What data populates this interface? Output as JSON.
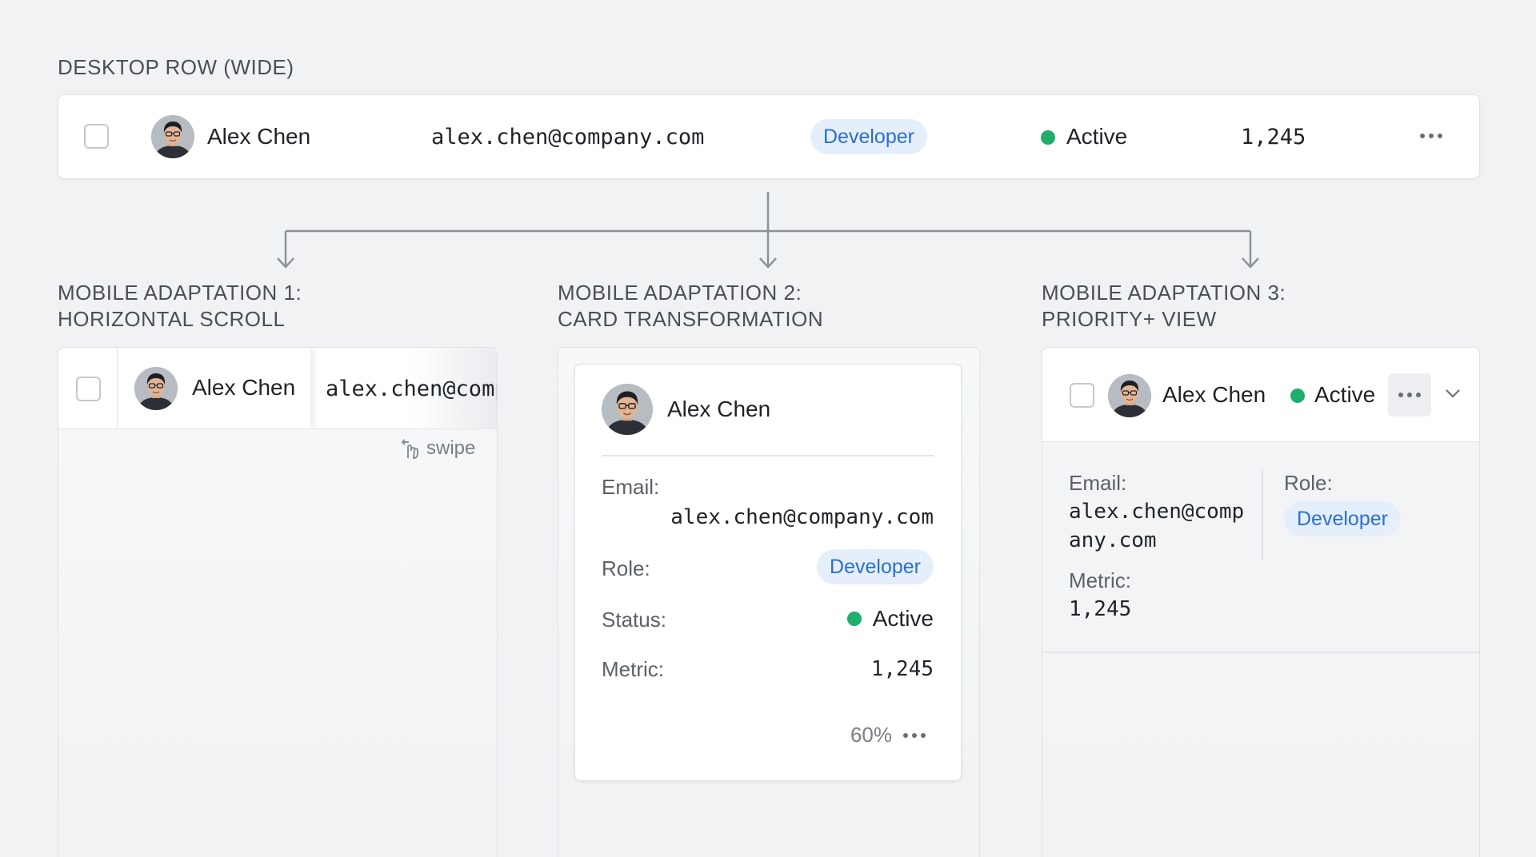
{
  "desktop": {
    "section_label": "DESKTOP ROW (WIDE)",
    "name": "Alex Chen",
    "email": "alex.chen@company.com",
    "role": "Developer",
    "status": "Active",
    "metric": "1,245"
  },
  "mobile1": {
    "section_label_line1": "MOBILE ADAPTATION 1:",
    "section_label_line2": "HORIZONTAL SCROLL",
    "name": "Alex Chen",
    "email_partial": "alex.chen@comp",
    "swipe_label": "swipe"
  },
  "mobile2": {
    "section_label_line1": "MOBILE ADAPTATION 2:",
    "section_label_line2": "CARD TRANSFORMATION",
    "name": "Alex Chen",
    "email_label": "Email:",
    "email": "alex.chen@company.com",
    "role_label": "Role:",
    "role": "Developer",
    "status_label": "Status:",
    "status": "Active",
    "metric_label": "Metric:",
    "metric": "1,245",
    "progress_text": "60%"
  },
  "mobile3": {
    "section_label_line1": "MOBILE ADAPTATION 3:",
    "section_label_line2": "PRIORITY+ VIEW",
    "name": "Alex Chen",
    "status": "Active",
    "email_label": "Email:",
    "email_line1": "alex.chen@comp",
    "email_line2": "any.com",
    "metric_label": "Metric:",
    "metric": "1,245",
    "role_label": "Role:",
    "role": "Developer"
  },
  "icons": {
    "more": "more-horizontal-icon",
    "chevron": "chevron-down-icon",
    "swipe": "hand-swipe-icon",
    "arrow": "arrow-down-icon"
  },
  "colors": {
    "background": "#f1f2f4",
    "status_active": "#1fae6c",
    "role_pill_bg": "#e5effb",
    "role_pill_text": "#2a6fcf"
  }
}
